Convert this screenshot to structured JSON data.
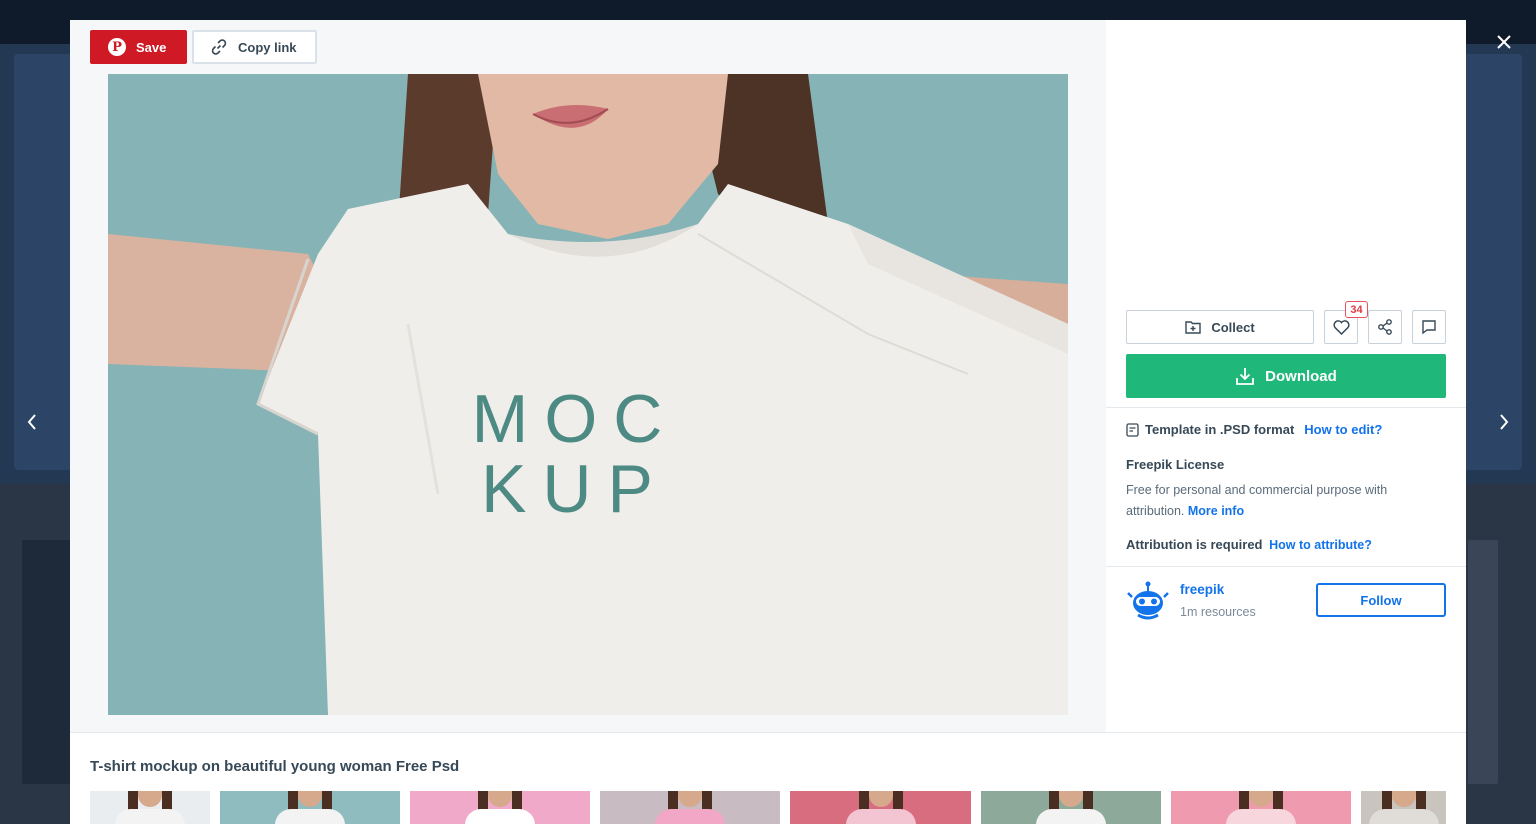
{
  "toolbar": {
    "save_label": "Save",
    "copy_link_label": "Copy link"
  },
  "photo": {
    "shirt_text_line1": "MOC",
    "shirt_text_line2": "KUP",
    "background_color": "#86b3b5",
    "shirt_text_color": "#4e8a84"
  },
  "actions": {
    "collect_label": "Collect",
    "like_count": "34",
    "download_label": "Download"
  },
  "details": {
    "format_text": "Template in .PSD format",
    "how_to_edit_link": "How to edit?",
    "license_title": "Freepik License",
    "license_text": "Free for personal and commercial purpose with attribution.",
    "more_info_link": "More info",
    "attribution_text": "Attribution is required",
    "how_to_attribute_link": "How to attribute?"
  },
  "author": {
    "name": "freepik",
    "resources": "1m resources",
    "follow_label": "Follow"
  },
  "resource": {
    "title": "T-shirt mockup on beautiful young woman Free Psd"
  },
  "related_thumbnails": [
    {
      "bg": "#e9edef",
      "shirt": "#f3f3f3"
    },
    {
      "bg": "#8fbcbf",
      "shirt": "#f3f3f3"
    },
    {
      "bg": "#f0a9c9",
      "shirt": "#ffffff"
    },
    {
      "bg": "#c8bbc2",
      "shirt": "#f2a7c6"
    },
    {
      "bg": "#d96d80",
      "shirt": "#f3c5d2"
    },
    {
      "bg": "#8da999",
      "shirt": "#f3f3f3"
    },
    {
      "bg": "#ef9aae",
      "shirt": "#f7d6de"
    },
    {
      "bg": "#c9c4be",
      "shirt": "#e0dcd7"
    }
  ],
  "colors": {
    "save_red": "#cf1a26",
    "download_green": "#1fb87a",
    "link_blue": "#1273eb"
  },
  "icons": [
    "close-icon",
    "chevron-left-icon",
    "chevron-right-icon",
    "pinterest-icon",
    "link-icon",
    "folder-plus-icon",
    "heart-icon",
    "share-icon",
    "comment-icon",
    "download-icon",
    "file-icon"
  ]
}
